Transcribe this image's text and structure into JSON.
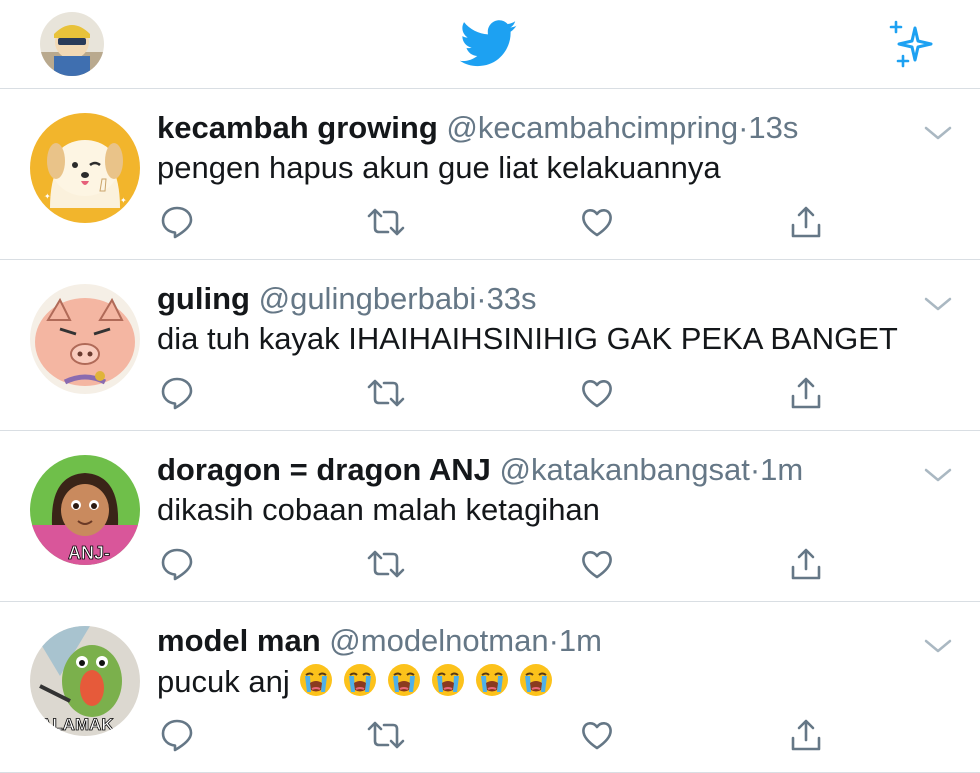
{
  "header": {
    "profile_avatar": "user-avatar",
    "logo": "twitter-bird-icon",
    "right_action": "sparkle-icon"
  },
  "tweets": [
    {
      "name": "kecambah growing",
      "handle": "@kecambahcimpring",
      "separator": "·",
      "time": "13s",
      "text": "pengen hapus akun gue liat kelakuannya"
    },
    {
      "name": "guling",
      "handle": "@gulingberbabi",
      "separator": "·",
      "time": "33s",
      "text": "dia tuh kayak IHAIHAIHSINIHIG GAK PEKA BANGET"
    },
    {
      "name": "doragon = dragon ANJ",
      "handle": "@katakanbangsat",
      "separator": "·",
      "time": "1m",
      "text": "dikasih cobaan malah ketagihan",
      "avatar_caption": "ANJ-"
    },
    {
      "name": "model man",
      "handle": "@modelnotman",
      "separator": "·",
      "time": "1m",
      "text": "pucuk anj",
      "text_emoji": [
        "😭",
        "😭",
        "😭",
        "😭",
        "😭",
        "😭"
      ],
      "avatar_caption": "ALAMAK"
    }
  ],
  "colors": {
    "twitter_blue": "#1da1f2",
    "secondary_text": "#657786",
    "divider": "#d9dee3",
    "icon_gray": "#657786"
  }
}
